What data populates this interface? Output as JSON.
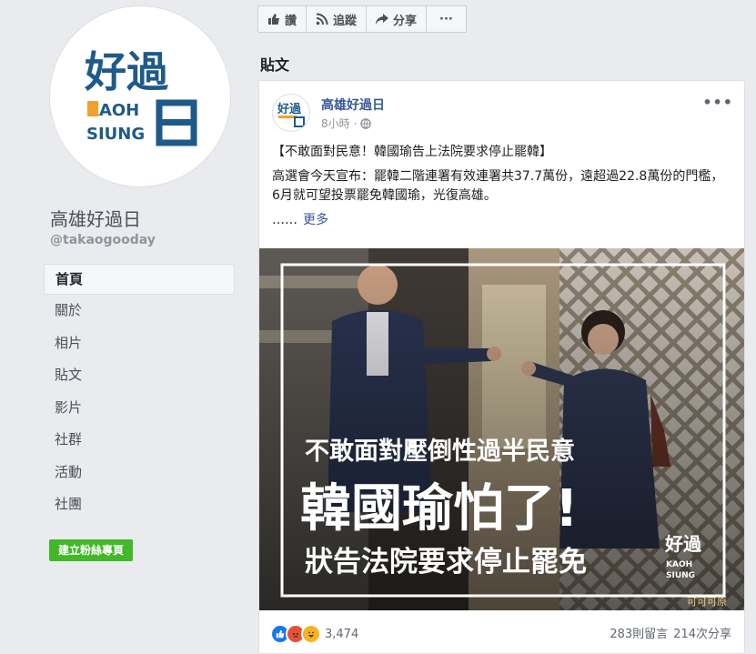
{
  "page": {
    "name": "高雄好過日",
    "handle": "@takaogooday",
    "logo": {
      "main": "好過",
      "line1": "KAOH",
      "line2": "SIUNG",
      "box": "日"
    }
  },
  "nav": [
    {
      "label": "首頁"
    },
    {
      "label": "關於"
    },
    {
      "label": "相片"
    },
    {
      "label": "貼文"
    },
    {
      "label": "影片"
    },
    {
      "label": "社群"
    },
    {
      "label": "活動"
    },
    {
      "label": "社團"
    }
  ],
  "create_page_label": "建立粉絲專頁",
  "toolbar": {
    "like_label": "讚",
    "follow_label": "追蹤",
    "share_label": "分享",
    "more_label": "···"
  },
  "posts_title": "貼文",
  "post": {
    "author": "高雄好過日",
    "time": "8小時",
    "headline": "【不敢面對民意！韓國瑜告上法院要求停止罷韓】",
    "body": "高選會今天宣布：罷韓二階連署有效連署共37.7萬份，遠超過22.8萬份的門檻，6月就可望投票罷免韓國瑜，光復高雄。",
    "ellipsis": "……",
    "more_label": "更多",
    "image_text": {
      "line1": "不敢面對壓倒性過半民意",
      "line2": "韓國瑜怕了!",
      "line3": "狀告法院要求停止罷免",
      "watermark": "可可可原"
    },
    "reaction_count": "3,474",
    "comments": "283則留言",
    "shares": "214次分享",
    "colors": {
      "like": "#1877f2",
      "angry": "#e4503a",
      "haha": "#f7b125"
    }
  }
}
